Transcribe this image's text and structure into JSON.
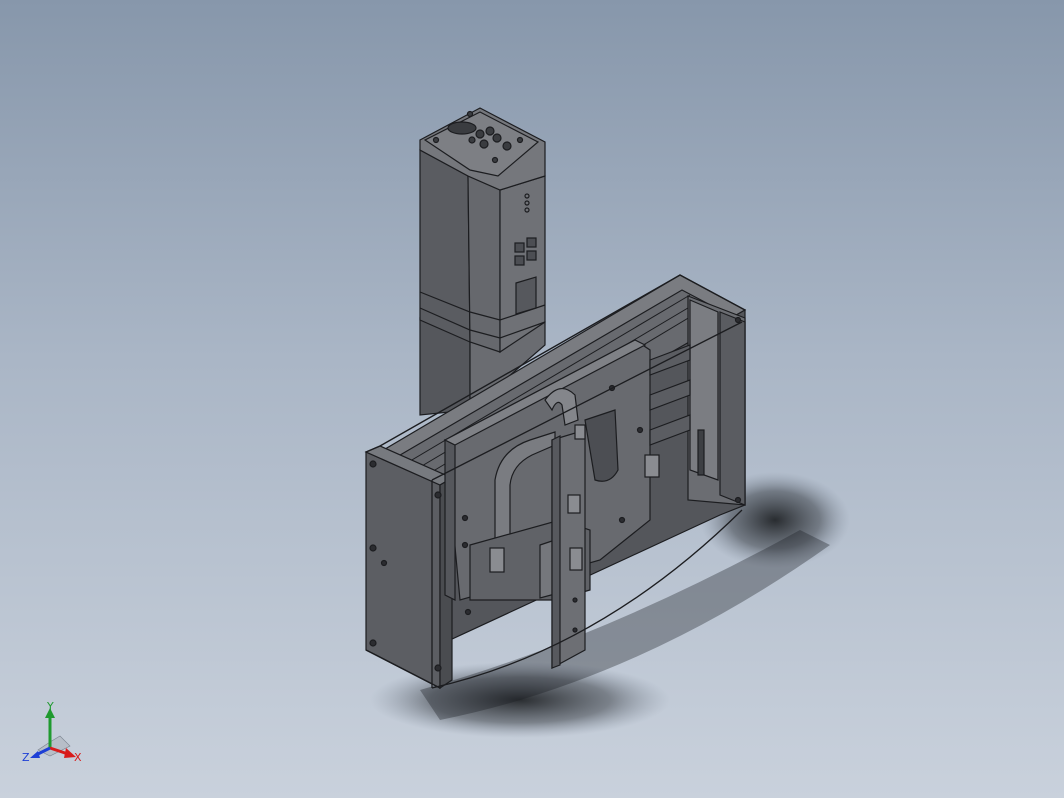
{
  "viewport": {
    "background_top": "#8797ab",
    "background_bottom": "#c9d1dc",
    "model_color": "#5f6166",
    "edge_color": "#1c1d20"
  },
  "triad": {
    "x_label": "X",
    "y_label": "Y",
    "z_label": "Z",
    "x_color": "#d81b1b",
    "y_color": "#1f9a2f",
    "z_color": "#1d3fd6"
  }
}
